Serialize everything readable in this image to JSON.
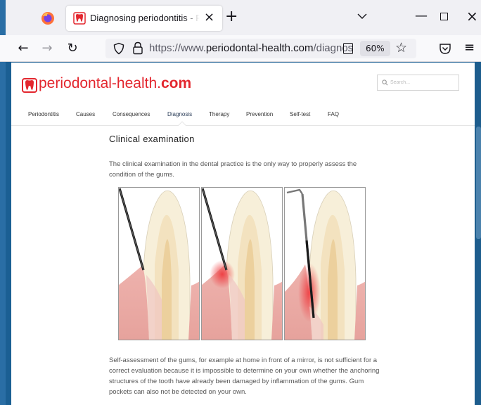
{
  "browser": {
    "tab_title": "Diagnosing periodontitis - Read",
    "tab_close": "×",
    "new_tab": "+",
    "window_min": "—",
    "window_close": "×",
    "url_prefix": "https://www.",
    "url_domain": "periodontal-health.com",
    "url_rest": "/diagnos",
    "zoom": "60%",
    "back": "←",
    "forward": "→",
    "reload": "↻",
    "bookmark_star": "☆",
    "menu": "≡"
  },
  "site": {
    "logo_light": "periodontal-health.",
    "logo_bold": "com",
    "search_placeholder": "Search...",
    "nav": [
      {
        "label": "Periodontitis"
      },
      {
        "label": "Causes"
      },
      {
        "label": "Consequences"
      },
      {
        "label": "Diagnosis",
        "active": true
      },
      {
        "label": "Therapy"
      },
      {
        "label": "Prevention"
      },
      {
        "label": "Self-test"
      },
      {
        "label": "FAQ"
      }
    ]
  },
  "article": {
    "heading": "Clinical examination",
    "para1": "The clinical examination in the dental practice is the only way to properly assess the condition of the gums.",
    "para2": "Self-assessment of the gums, for example at home in front of a mirror, is not sufficient for a correct evaluation because it is impossible to determine on your own whether the anchoring structures of the tooth have already been damaged by inflammation of the gums. Gum pockets can also not be detected on your own."
  },
  "colors": {
    "brand_red": "#e3262e",
    "desktop_blue": "#1b5f93",
    "gum_pink": "#e9a9a5",
    "tooth_ivory": "#f7efd9"
  },
  "icons": [
    "firefox-icon",
    "site-favicon",
    "shield-icon",
    "lock-icon",
    "reader-view-icon",
    "star-icon",
    "pocket-icon",
    "menu-icon",
    "search-icon"
  ]
}
